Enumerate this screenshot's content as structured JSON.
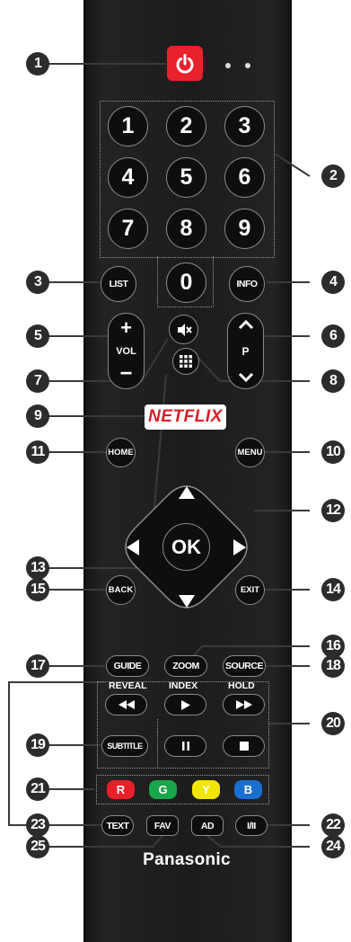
{
  "remote": {
    "brand": "Panasonic",
    "netflix_label": "NETFLIX",
    "digits": [
      "1",
      "2",
      "3",
      "4",
      "5",
      "6",
      "7",
      "8",
      "9",
      "0"
    ],
    "list_label": "LIST",
    "info_label": "INFO",
    "vol_label": "VOL",
    "vol_plus": "+",
    "vol_minus": "−",
    "p_label": "P",
    "ok_label": "OK",
    "home_label": "HOME",
    "menu_label": "MENU",
    "back_label": "BACK",
    "exit_label": "EXIT",
    "guide_label": "GUIDE",
    "zoom_label": "ZOOM",
    "source_label": "SOURCE",
    "reveal_label": "REVEAL",
    "index_label": "INDEX",
    "hold_label": "HOLD",
    "subtitle_label": "SUBTITLE",
    "color_keys": [
      {
        "label": "R",
        "color": "#e8202a"
      },
      {
        "label": "G",
        "color": "#1aa64a"
      },
      {
        "label": "Y",
        "color": "#f2e600"
      },
      {
        "label": "B",
        "color": "#1b6fd0"
      }
    ],
    "text_label": "TEXT",
    "fav_label": "FAV",
    "ad_label": "AD",
    "audio_label": "I/II",
    "power_color": "#e8222d"
  },
  "callouts": [
    "1",
    "2",
    "3",
    "4",
    "5",
    "6",
    "7",
    "8",
    "9",
    "10",
    "11",
    "12",
    "13",
    "14",
    "15",
    "16",
    "17",
    "18",
    "19",
    "20",
    "21",
    "22",
    "23",
    "24",
    "25"
  ]
}
